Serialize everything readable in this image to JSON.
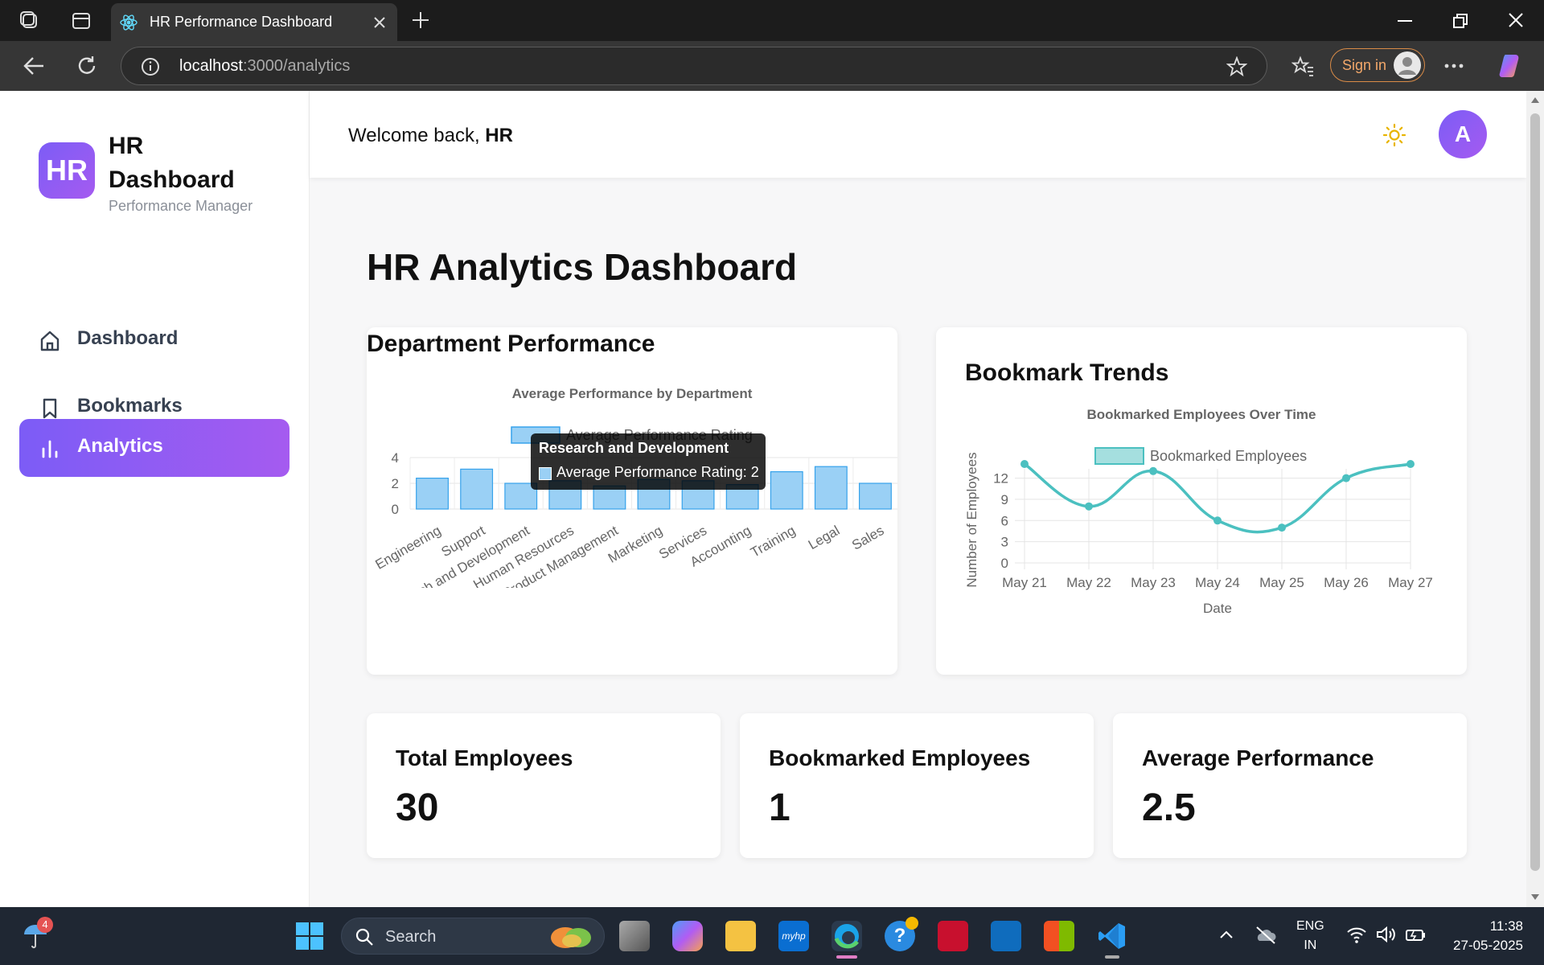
{
  "browser": {
    "tab_title": "HR Performance Dashboard",
    "url_host": "localhost",
    "url_path": ":3000/analytics",
    "signin_label": "Sign in"
  },
  "sidebar": {
    "logo_text": "HR",
    "brand_title": "HR Dashboard",
    "brand_subtitle": "Performance Manager",
    "items": [
      {
        "label": "Dashboard",
        "icon": "home-icon",
        "active": false
      },
      {
        "label": "Bookmarks",
        "icon": "bookmark-icon",
        "active": false
      },
      {
        "label": "Analytics",
        "icon": "bar-chart-icon",
        "active": true
      }
    ]
  },
  "header": {
    "welcome_prefix": "Welcome back, ",
    "welcome_name": "HR",
    "theme_icon": "sun-icon",
    "avatar_initial": "A"
  },
  "page": {
    "title": "HR Analytics Dashboard"
  },
  "dept_card": {
    "title": "Department Performance"
  },
  "trend_card": {
    "title": "Bookmark Trends"
  },
  "tooltip": {
    "title": "Research and Development",
    "body": "Average Performance Rating: 2"
  },
  "stats": [
    {
      "label": "Total Employees",
      "value": "30"
    },
    {
      "label": "Bookmarked Employees",
      "value": "1"
    },
    {
      "label": "Average Performance",
      "value": "2.5"
    }
  ],
  "taskbar": {
    "search_label": "Search",
    "weather_badge": "4",
    "lang_line1": "ENG",
    "lang_line2": "IN",
    "time": "11:38",
    "date": "27-05-2025"
  },
  "colors": {
    "accent": "#8b5cf6",
    "bar_fill": "#9ad0f5",
    "bar_stroke": "#36a2eb",
    "line": "#4bc0c0"
  },
  "chart_data": [
    {
      "type": "bar",
      "title": "Average Performance by Department",
      "categories": [
        "Engineering",
        "Support",
        "Research and Development",
        "Human Resources",
        "Product Management",
        "Marketing",
        "Services",
        "Accounting",
        "Training",
        "Legal",
        "Sales"
      ],
      "series": [
        {
          "name": "Average Performance Rating",
          "values": [
            2.4,
            3.1,
            2,
            2.2,
            1.8,
            2.3,
            2.2,
            1.9,
            2.9,
            3.3,
            2
          ]
        }
      ],
      "ylim": [
        0,
        4
      ],
      "yticks": [
        0,
        2,
        4
      ],
      "legend": "top"
    },
    {
      "type": "line",
      "title": "Bookmarked Employees Over Time",
      "categories": [
        "May 21",
        "May 22",
        "May 23",
        "May 24",
        "May 25",
        "May 26",
        "May 27"
      ],
      "series": [
        {
          "name": "Bookmarked Employees",
          "values": [
            14,
            8,
            13,
            6,
            5,
            12,
            14
          ]
        }
      ],
      "xlabel": "Date",
      "ylabel": "Number of Employees",
      "ylim": [
        0,
        14
      ],
      "yticks": [
        0,
        3,
        6,
        9,
        12
      ],
      "grid": true,
      "legend": "top"
    }
  ]
}
